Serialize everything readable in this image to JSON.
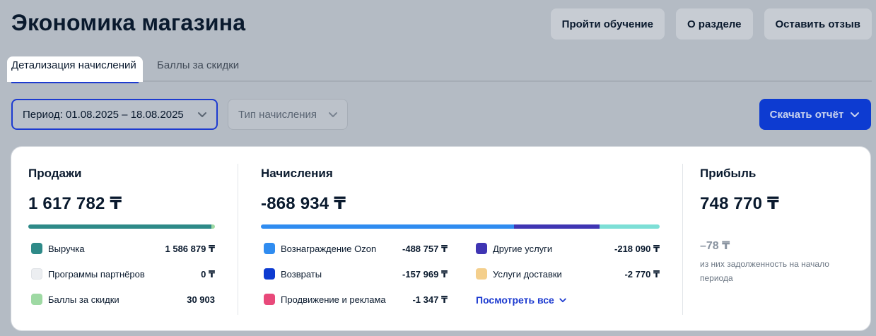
{
  "header": {
    "title": "Экономика магазина",
    "actions": [
      {
        "label": "Пройти обучение"
      },
      {
        "label": "О разделе"
      },
      {
        "label": "Оставить отзыв"
      }
    ]
  },
  "tabs": [
    {
      "label": "Детализация начислений",
      "active": true
    },
    {
      "label": "Баллы за скидки",
      "active": false
    }
  ],
  "filters": {
    "period": "Период: 01.08.2025 – 18.08.2025",
    "type_placeholder": "Тип начисления"
  },
  "download_label": "Скачать отчёт",
  "sales": {
    "title": "Продажи",
    "amount": "1 617 782 ₸",
    "items": [
      {
        "label": "Выручка",
        "value": "1 586 879 ₸",
        "color": "#2e8a88",
        "amount": 1586879
      },
      {
        "label": "Программы партнёров",
        "value": "0 ₸",
        "color": "#eceef1",
        "amount": 0
      },
      {
        "label": "Баллы за скидки",
        "value": "30 903",
        "color": "#9ed9a3",
        "amount": 30903
      }
    ]
  },
  "charges": {
    "title": "Начисления",
    "amount": "-868 934 ₸",
    "items": [
      {
        "label": "Вознаграждение Ozon",
        "value": "-488 757 ₸",
        "color": "#2f8cf0",
        "amount": 488757
      },
      {
        "label": "Возвраты",
        "value": "-157 969 ₸",
        "color": "#0d3bd1",
        "amount": 157969
      },
      {
        "label": "Продвижение и реклама",
        "value": "-1 347 ₸",
        "color": "#e8497a",
        "amount": 1347
      },
      {
        "label": "Другие услуги",
        "value": "-218 090 ₸",
        "color": "#3f35b3",
        "amount": 218090
      },
      {
        "label": "Услуги доставки",
        "value": "-2 770 ₸",
        "color": "#f4cf8c",
        "amount": 2770
      }
    ],
    "bar_colors": [
      "#2f8cf0",
      "#3f35b3",
      "#7ddfd6"
    ],
    "see_all": "Посмотреть все"
  },
  "profit": {
    "title": "Прибыль",
    "amount": "748 770 ₸",
    "debt_amount": "–78 ₸",
    "debt_note": "из них задолженность на начало периода"
  }
}
